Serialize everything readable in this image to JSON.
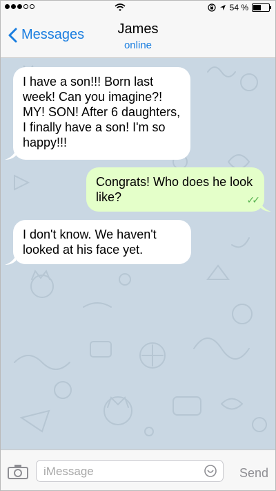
{
  "status_bar": {
    "battery_text": "54 %",
    "battery_level": 0.54,
    "icons": [
      "signal-dots-icon",
      "wifi-icon",
      "lock-rotation-icon",
      "location-arrow-icon",
      "battery-icon"
    ]
  },
  "header": {
    "back_label": "Messages",
    "title": "James",
    "subtitle": "online"
  },
  "messages": [
    {
      "direction": "incoming",
      "text": "I have a son!!! Born last week! Can you imagine?! MY! SON! After 6 daughters, I finally have a son! I'm so happy!!!"
    },
    {
      "direction": "outgoing",
      "text": "Congrats! Who does he look like?",
      "status": "read"
    },
    {
      "direction": "incoming",
      "text": "I don't know. We haven't looked at his face yet."
    }
  ],
  "input_bar": {
    "placeholder": "iMessage",
    "send_label": "Send"
  },
  "colors": {
    "accent": "#1a7ee0",
    "chat_background": "#c9d7e3",
    "outgoing_bubble": "#e4ffc9",
    "incoming_bubble": "#ffffff",
    "read_ticks": "#58b350"
  }
}
